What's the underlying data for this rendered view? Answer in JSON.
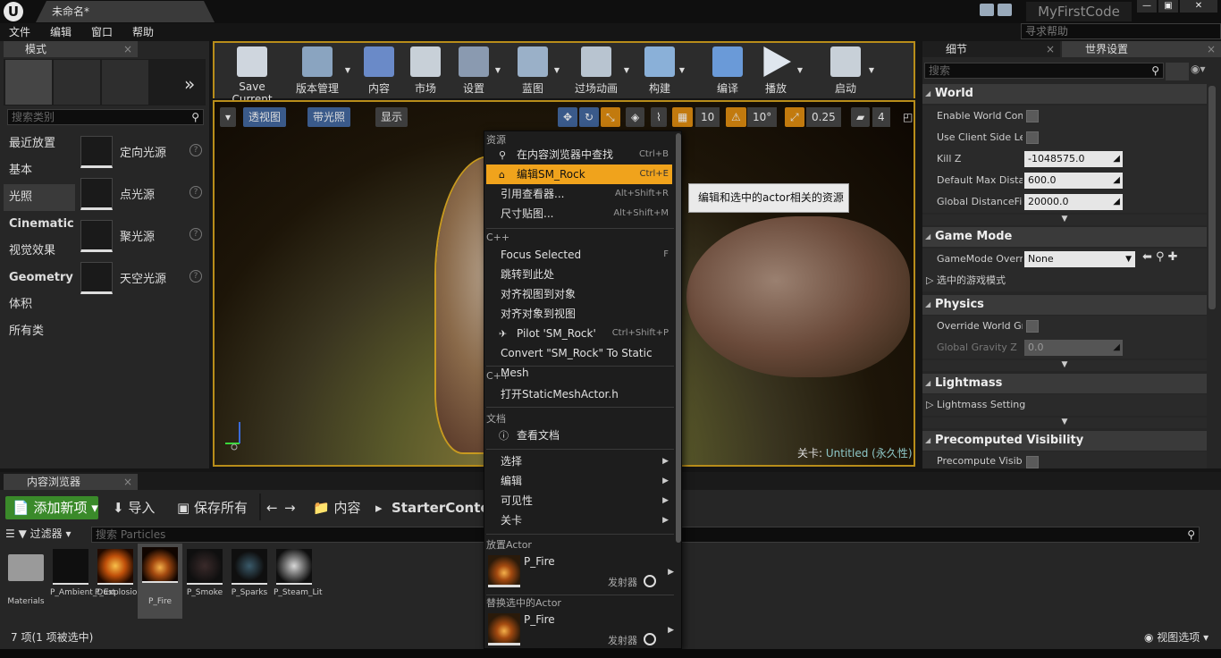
{
  "titlebar": {
    "doc_tab": "未命名*",
    "project_name": "MyFirstCode",
    "help_search_placeholder": "寻求帮助"
  },
  "menubar": {
    "items": [
      "文件",
      "编辑",
      "窗口",
      "帮助"
    ]
  },
  "modes": {
    "tab_title": "模式",
    "search_placeholder": "搜索类别",
    "categories": [
      "最近放置",
      "基本",
      "光照",
      "Cinematic",
      "视觉效果",
      "Geometry",
      "体积",
      "所有类"
    ],
    "selected_category": "光照",
    "items": [
      "定向光源",
      "点光源",
      "聚光源",
      "天空光源"
    ]
  },
  "toolbar": {
    "buttons": [
      "Save Current",
      "版本管理",
      "内容",
      "市场",
      "设置",
      "蓝图",
      "过场动画",
      "构建",
      "编译",
      "播放",
      "启动"
    ]
  },
  "viewport": {
    "perspective": "透视图",
    "lit": "带光照",
    "show": "显示",
    "grid_size": "10",
    "rotation_snap": "10°",
    "scale_snap": "0.25",
    "camera_speed": "4",
    "level_prefix": "关卡:",
    "level_name": "Untitled (永久性)"
  },
  "context_menu": {
    "sec_assets": "资源",
    "find_in_cb": "在内容浏览器中查找",
    "find_in_cb_sc": "Ctrl+B",
    "edit_asset": "编辑SM_Rock",
    "edit_asset_sc": "Ctrl+E",
    "ref_viewer": "引用查看器...",
    "ref_viewer_sc": "Alt+Shift+R",
    "size_map": "尺寸贴图...",
    "size_map_sc": "Alt+Shift+M",
    "sec_cpp": "C++",
    "focus_selected": "Focus Selected",
    "focus_selected_sc": "F",
    "go_here": "跳转到此处",
    "snap_view": "对齐视图到对象",
    "snap_object": "对齐对象到视图",
    "pilot": "Pilot 'SM_Rock'",
    "pilot_sc": "Ctrl+Shift+P",
    "convert": "Convert \"SM_Rock\" To Static Mesh",
    "sec_cpp2": "C++",
    "open_header": "打开StaticMeshActor.h",
    "sec_docs": "文档",
    "view_docs": "查看文档",
    "select": "选择",
    "edit": "编辑",
    "visibility": "可见性",
    "level": "关卡",
    "sec_place": "放置Actor",
    "place_name": "P_Fire",
    "place_type": "发射器",
    "sec_replace": "替换选中的Actor",
    "replace_name": "P_Fire",
    "replace_type": "发射器"
  },
  "tooltip": "编辑和选中的actor相关的资源",
  "details": {
    "tab_details": "细节",
    "tab_world": "世界设置",
    "search_placeholder": "搜索",
    "world_header": "World",
    "enable_world_comp": "Enable World Comp",
    "use_client_side": "Use Client Side Le",
    "kill_z_label": "Kill Z",
    "kill_z_value": "-1048575.0",
    "max_dist_label": "Default Max Distar",
    "max_dist_value": "600.0",
    "global_df_label": "Global DistanceFie",
    "global_df_value": "20000.0",
    "gamemode_header": "Game Mode",
    "gamemode_label": "GameMode Overri",
    "gamemode_value": "None",
    "selected_gamemode": "选中的游戏模式",
    "physics_header": "Physics",
    "override_gravity": "Override World Gra",
    "global_gravity_label": "Global Gravity Z",
    "global_gravity_value": "0.0",
    "lightmass_header": "Lightmass",
    "lightmass_settings": "Lightmass Setting",
    "precomputed_header": "Precomputed Visibility",
    "precompute_label": "Precompute Visibi"
  },
  "content_browser": {
    "tab_title": "内容浏览器",
    "add_new": "添加新项",
    "import": "导入",
    "save_all": "保存所有",
    "path_root": "内容",
    "path_folder": "StarterContent",
    "filters": "过滤器",
    "search_placeholder": "搜索 Particles",
    "assets": [
      "Materials",
      "P_Ambient_Dust",
      "P_Explosion",
      "P_Fire",
      "P_Smoke",
      "P_Sparks",
      "P_Steam_Lit"
    ],
    "selected_asset": "P_Fire",
    "status": "7 项(1 项被选中)",
    "view_options": "视图选项"
  },
  "colors": {
    "accent": "#f0a31c",
    "add_new": "#3a8a2a",
    "viewport_border": "#b88d1a"
  }
}
